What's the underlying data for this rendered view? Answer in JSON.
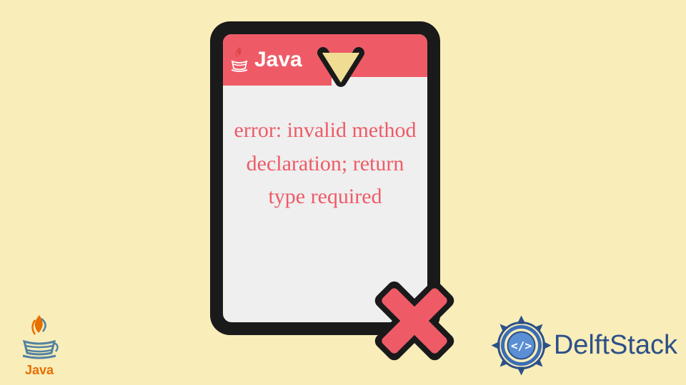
{
  "card": {
    "java_label": "Java",
    "error_message": "error: invalid method declaration; return type required"
  },
  "branding": {
    "bottom_left_logo": "Java",
    "bottom_right_text": "DelftStack"
  },
  "colors": {
    "background": "#f9edb9",
    "accent": "#ee5b67",
    "card_bg": "#efefef",
    "card_border": "#1a1a1a",
    "delft_blue": "#2c5088"
  },
  "icons": {
    "java_cup": "java-cup-icon",
    "error_x": "error-x-icon",
    "delft_gear": "delft-gear-icon"
  }
}
